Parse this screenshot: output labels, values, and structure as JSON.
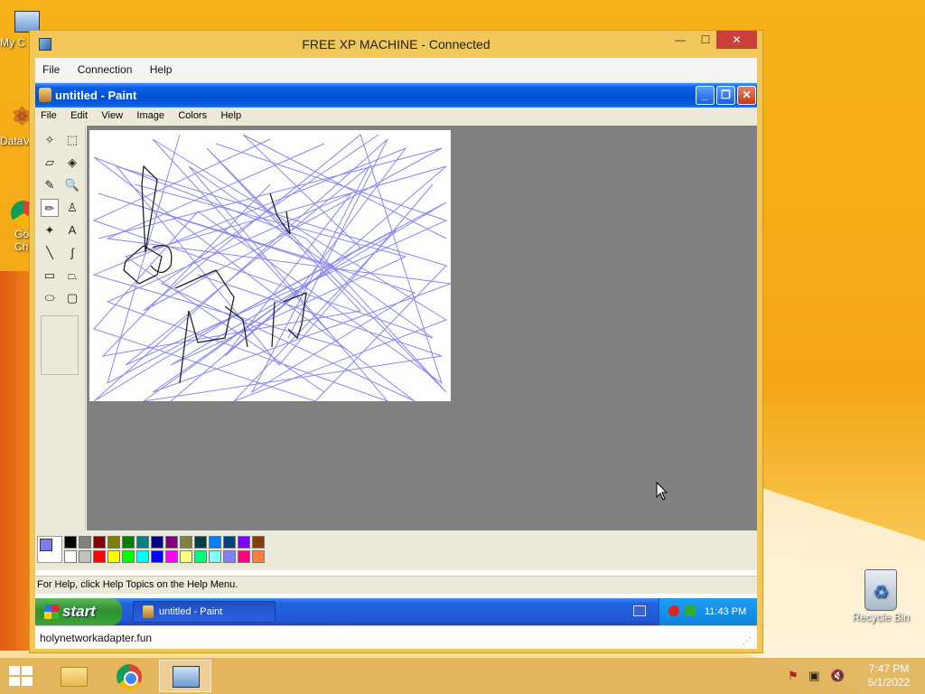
{
  "desktop": {
    "icons": [
      {
        "label": "My C",
        "name": "my-computer"
      },
      {
        "label": "DataV",
        "name": "datav"
      },
      {
        "label": "Go",
        "name": "google-chrome-partial-1"
      },
      {
        "label": "Chr",
        "name": "google-chrome-partial-2"
      }
    ],
    "recycle_bin": "Recycle Bin"
  },
  "rdp_window": {
    "title": "FREE XP MACHINE - Connected",
    "controls": {
      "minimize": "—",
      "maximize": "☐",
      "close": "✕"
    },
    "menu": [
      "File",
      "Connection",
      "Help"
    ],
    "status_url": "holynetworkadapter.fun"
  },
  "paint": {
    "title": "untitled - Paint",
    "menu": [
      "File",
      "Edit",
      "View",
      "Image",
      "Colors",
      "Help"
    ],
    "status": "For Help, click Help Topics on the Help Menu.",
    "tools": [
      {
        "name": "free-form-select-icon",
        "glyph": "✧"
      },
      {
        "name": "select-icon",
        "glyph": "⬚"
      },
      {
        "name": "eraser-icon",
        "glyph": "▱"
      },
      {
        "name": "fill-icon",
        "glyph": "◈"
      },
      {
        "name": "color-picker-icon",
        "glyph": "✎"
      },
      {
        "name": "magnifier-icon",
        "glyph": "🔍"
      },
      {
        "name": "pencil-icon",
        "glyph": "✏"
      },
      {
        "name": "brush-icon",
        "glyph": "♙"
      },
      {
        "name": "airbrush-icon",
        "glyph": "✦"
      },
      {
        "name": "text-icon",
        "glyph": "A"
      },
      {
        "name": "line-icon",
        "glyph": "╲"
      },
      {
        "name": "curve-icon",
        "glyph": "∫"
      },
      {
        "name": "rectangle-icon",
        "glyph": "▭"
      },
      {
        "name": "polygon-icon",
        "glyph": "⏢"
      },
      {
        "name": "ellipse-icon",
        "glyph": "⬭"
      },
      {
        "name": "rounded-rectangle-icon",
        "glyph": "▢"
      }
    ],
    "palette_top": [
      "#000000",
      "#808080",
      "#800000",
      "#808000",
      "#008000",
      "#008080",
      "#000080",
      "#800080",
      "#808040",
      "#004040",
      "#0080ff",
      "#004080",
      "#8000ff",
      "#804000"
    ],
    "palette_bottom": [
      "#ffffff",
      "#c0c0c0",
      "#ff0000",
      "#ffff00",
      "#00ff00",
      "#00ffff",
      "#0000ff",
      "#ff00ff",
      "#ffff80",
      "#00ff80",
      "#80ffff",
      "#8080ff",
      "#ff0080",
      "#ff8040"
    ],
    "foreground_color": "#7b7cf0"
  },
  "xp_taskbar": {
    "start_label": "start",
    "task_label": "untitled - Paint",
    "clock": "11:43 PM"
  },
  "win8_taskbar": {
    "time": "7:47 PM",
    "date": "5/1/2022"
  }
}
